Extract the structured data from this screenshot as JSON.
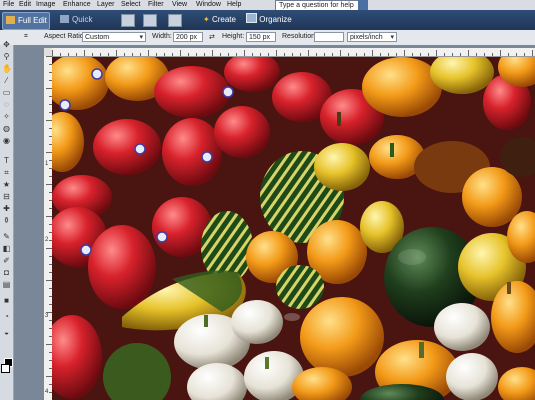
{
  "menubar": {
    "items": [
      "File",
      "Edit",
      "Image",
      "Enhance",
      "Layer",
      "Select",
      "Filter",
      "View",
      "Window",
      "Help"
    ],
    "help_placeholder": "Type a question for help"
  },
  "topbar": {
    "full_edit": "Full Edit",
    "quick_fix": "Quick Fix",
    "create": "Create",
    "organize": "Organize"
  },
  "options": {
    "aspect_ratio_label": "Aspect Ratio:",
    "aspect_ratio_value": "Custom",
    "width_label": "Width:",
    "width_value": "200 px",
    "height_label": "Height:",
    "height_value": "150 px",
    "resolution_label": "Resolution:",
    "resolution_value": "",
    "resolution_unit": "pixels/inch"
  },
  "rulers": {
    "left_numbers": [
      "1",
      "2",
      "3",
      "4"
    ]
  },
  "colors": {
    "app_dark": "#1f3556",
    "menu_bg": "#d9dde3",
    "panel_bg": "#e4e7ec"
  }
}
